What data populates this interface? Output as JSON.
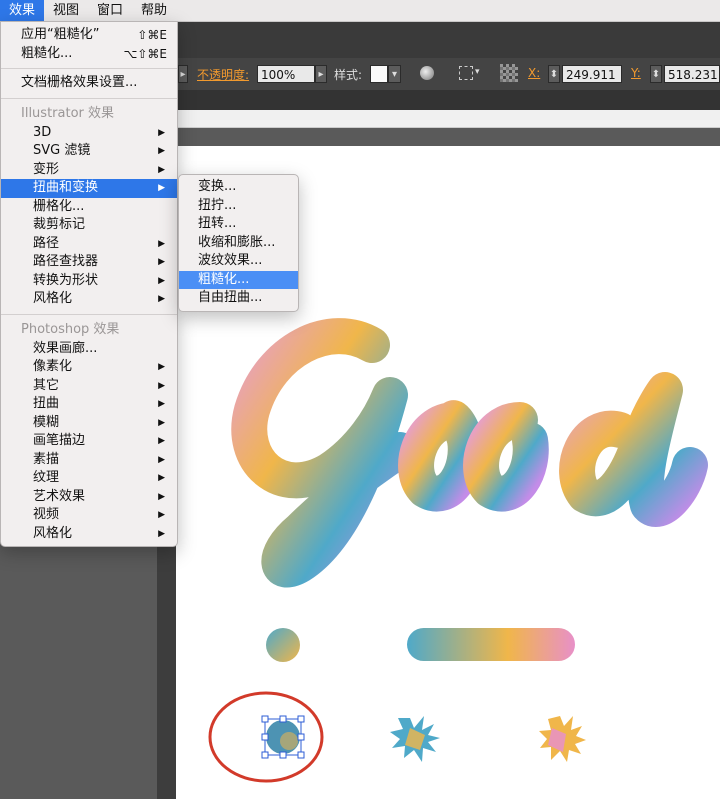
{
  "menubar": {
    "items": [
      {
        "label": "效果",
        "active": true
      },
      {
        "label": "视图"
      },
      {
        "label": "窗口"
      },
      {
        "label": "帮助"
      }
    ]
  },
  "controlbar": {
    "opacity_label": "不透明度:",
    "opacity_value": "100%",
    "style_label": "样式:",
    "x_label": "X:",
    "x_value": "249.911 m",
    "y_label": "Y:",
    "y_value": "518.231"
  },
  "effect_menu": {
    "apply_last": {
      "label": "应用“粗糙化”",
      "shortcut": "⇧⌘E"
    },
    "last_effect": {
      "label": "粗糙化...",
      "shortcut": "⌥⇧⌘E"
    },
    "raster_settings": "文档栅格效果设置...",
    "illustrator_header": "Illustrator 效果",
    "illustrator_items": [
      {
        "label": "3D",
        "submenu": true
      },
      {
        "label": "SVG 滤镜",
        "submenu": true
      },
      {
        "label": "变形",
        "submenu": true
      },
      {
        "label": "扭曲和变换",
        "submenu": true,
        "highlighted": true
      },
      {
        "label": "栅格化...",
        "submenu": false
      },
      {
        "label": "裁剪标记",
        "submenu": false
      },
      {
        "label": "路径",
        "submenu": true
      },
      {
        "label": "路径查找器",
        "submenu": true
      },
      {
        "label": "转换为形状",
        "submenu": true
      },
      {
        "label": "风格化",
        "submenu": true
      }
    ],
    "photoshop_header": "Photoshop 效果",
    "photoshop_items": [
      {
        "label": "效果画廊...",
        "submenu": false
      },
      {
        "label": "像素化",
        "submenu": true
      },
      {
        "label": "其它",
        "submenu": true
      },
      {
        "label": "扭曲",
        "submenu": true
      },
      {
        "label": "模糊",
        "submenu": true
      },
      {
        "label": "画笔描边",
        "submenu": true
      },
      {
        "label": "素描",
        "submenu": true
      },
      {
        "label": "纹理",
        "submenu": true
      },
      {
        "label": "艺术效果",
        "submenu": true
      },
      {
        "label": "视频",
        "submenu": true
      },
      {
        "label": "风格化",
        "submenu": true
      }
    ]
  },
  "distort_submenu": {
    "items": [
      {
        "label": "变换..."
      },
      {
        "label": "扭拧..."
      },
      {
        "label": "扭转..."
      },
      {
        "label": "收缩和膨胀..."
      },
      {
        "label": "波纹效果..."
      },
      {
        "label": "粗糙化...",
        "highlighted": true
      },
      {
        "label": "自由扭曲..."
      }
    ]
  },
  "canvas": {
    "lettering": "Good",
    "gradient_colors": [
      "#e7a0c4",
      "#f0b64a",
      "#4fa9c9",
      "#c48ce8"
    ],
    "highlight_ring_color": "#d23a2a"
  }
}
